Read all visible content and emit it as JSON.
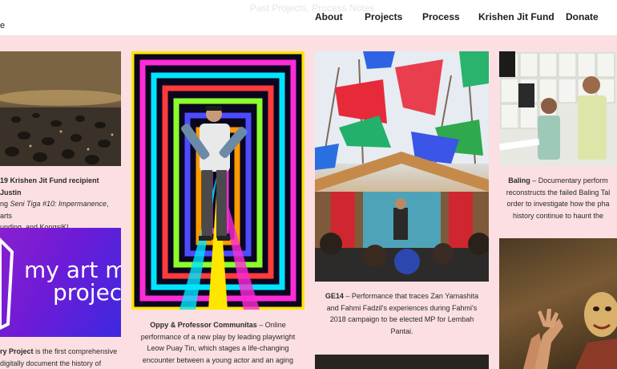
{
  "header": {
    "ghost_text": "Past Projects, Process Notes",
    "logo_fragment": "e",
    "nav": [
      {
        "label": "About"
      },
      {
        "label": "Projects"
      },
      {
        "label": "Process"
      },
      {
        "label": "Krishen Jit Fund"
      },
      {
        "label": "Donate"
      }
    ]
  },
  "tiles": {
    "t1": {
      "caption": {
        "title": "19 Krishen Jit Fund recipient Justin",
        "line2_pre": "ng ",
        "line2_em": "Seni Tiga #10: Impermanence",
        "line2_post": ", arts",
        "line3": "unding, and KongsiKL."
      }
    },
    "t2": {
      "logo_text_line1": "my art m",
      "logo_text_line2": "projec",
      "caption": {
        "title": "ry Project",
        "text1": " is the first comprehensive",
        "text2": "digitally document the history of"
      }
    },
    "t3": {
      "caption": {
        "title": "Oppy & Professor Communitas",
        "text1": " – Online",
        "text2": "performance of a new play by leading playwright",
        "text3": "Leow Puay Tin, which stages a life-changing",
        "text4": "encounter between a young actor and an aging"
      }
    },
    "t4": {
      "caption": {
        "title": "GE14",
        "text1": " – Performance that traces Zan Yamashita",
        "text2": "and Fahmi Fadzil's experiences during Fahmi's",
        "text3": "2018 campaign to be elected MP for Lembah",
        "text4": "Pantai."
      }
    },
    "t6": {
      "caption": {
        "title": "Baling",
        "text1": " – Documentary perform",
        "text2": "reconstructs the failed Baling Tal",
        "text3": "order to investigate how the pha",
        "text4": "history continue to haunt the"
      }
    }
  }
}
